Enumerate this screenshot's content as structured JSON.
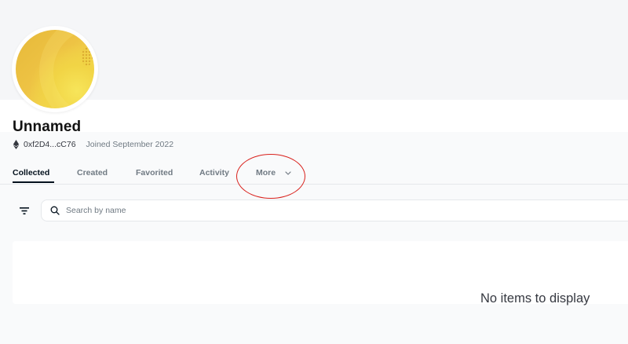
{
  "profile": {
    "name": "Unnamed",
    "address": "0xf2D4...cC76",
    "joined": "Joined September 2022"
  },
  "tabs": [
    {
      "label": "Collected",
      "active": true
    },
    {
      "label": "Created",
      "active": false
    },
    {
      "label": "Favorited",
      "active": false
    },
    {
      "label": "Activity",
      "active": false
    },
    {
      "label": "More",
      "active": false
    }
  ],
  "search": {
    "placeholder": "Search by name",
    "value": ""
  },
  "empty_state": {
    "message": "No items to display"
  },
  "icons": {
    "currency": "ethereum-icon",
    "filter": "filter-icon",
    "search": "search-icon",
    "more": "chevron-down-icon"
  },
  "colors": {
    "annotation": "#d9211c",
    "text_primary": "#04111d",
    "text_secondary": "#707a83"
  }
}
